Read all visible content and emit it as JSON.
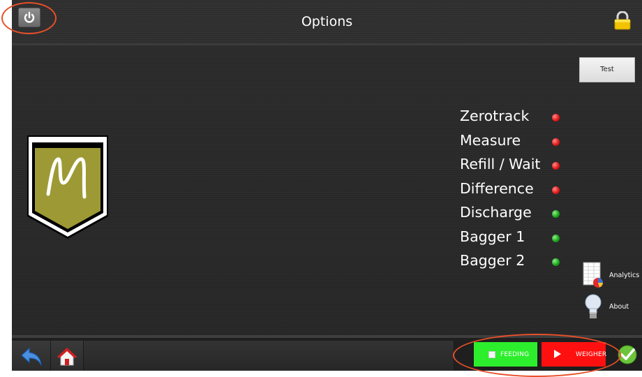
{
  "header": {
    "title": "Options",
    "power_icon": "power-icon",
    "lock_icon": "lock-icon"
  },
  "buttons": {
    "test": "Test"
  },
  "status": [
    {
      "label": "Zerotrack",
      "state": "red"
    },
    {
      "label": "Measure",
      "state": "red"
    },
    {
      "label": "Refill / Wait",
      "state": "red"
    },
    {
      "label": "Difference",
      "state": "red"
    },
    {
      "label": "Discharge",
      "state": "green"
    },
    {
      "label": "Bagger 1",
      "state": "green"
    },
    {
      "label": "Bagger 2",
      "state": "green"
    }
  ],
  "logo": {
    "letter": "M"
  },
  "side_menu": {
    "analytics": "Analytics",
    "about": "About"
  },
  "footer": {
    "feeding": "FEEDING",
    "weigher": "WEIGHER",
    "back_icon": "back-arrow-icon",
    "home_icon": "home-icon",
    "confirm_icon": "checkmark-icon"
  },
  "colors": {
    "status_red": "#e31b1b",
    "status_green": "#1ea51e",
    "feeding_bg": "#2dee2d",
    "weigher_bg": "#ff1010",
    "logo_olive": "#9d9a35",
    "annotation": "#e84f2a"
  }
}
